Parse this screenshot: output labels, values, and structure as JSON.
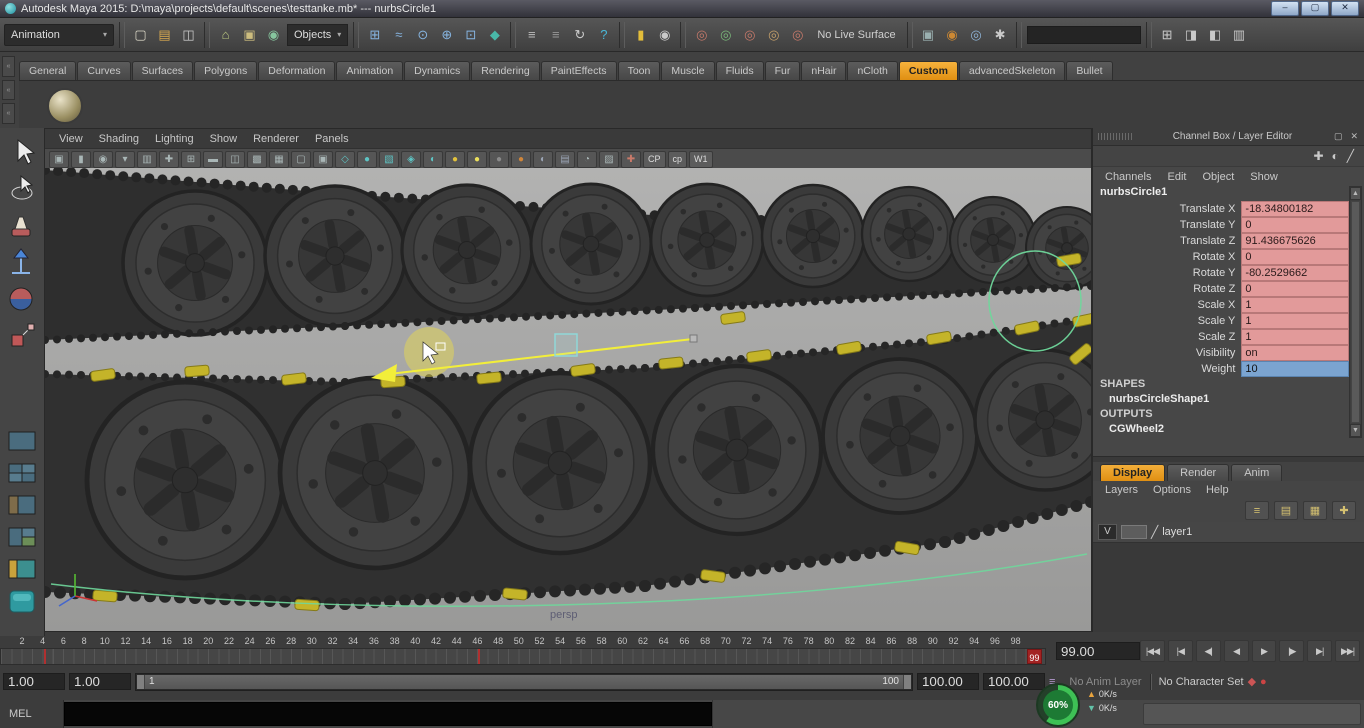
{
  "titlebar": {
    "title": "Autodesk Maya 2015: D:\\maya\\projects\\default\\scenes\\testtanke.mb*   ---   nurbsCircle1",
    "minimize": "–",
    "maximize": "▢",
    "close": "✕"
  },
  "toolbar": {
    "menuset": "Animation",
    "live_surface_label": "No Live Surface",
    "coordinate_input_value": "",
    "items": [
      {
        "t": "i",
        "n": "new-scene",
        "g": "▢",
        "c": "#d8d4c4"
      },
      {
        "t": "i",
        "n": "open-scene",
        "g": "▤",
        "c": "#d9a94f"
      },
      {
        "t": "i",
        "n": "save-scene",
        "g": "◫",
        "c": "#c9c9c9"
      },
      {
        "t": "sep"
      },
      {
        "t": "i",
        "n": "select-by-hierarchy",
        "g": "⌂",
        "c": "#bac87f"
      },
      {
        "t": "i",
        "n": "select-by-object-type",
        "g": "▣",
        "c": "#cdbd7e"
      },
      {
        "t": "i",
        "n": "select-by-component-type",
        "g": "◉",
        "c": "#86c79e"
      },
      {
        "t": "field",
        "n": "selection-mask",
        "label": "Objects"
      },
      {
        "t": "sep"
      },
      {
        "t": "i",
        "n": "snap-to-grid",
        "g": "⊞",
        "c": "#86b4e0"
      },
      {
        "t": "i",
        "n": "snap-to-curve",
        "g": "≈",
        "c": "#86b4e0"
      },
      {
        "t": "i",
        "n": "snap-to-point",
        "g": "⊙",
        "c": "#86b4e0"
      },
      {
        "t": "i",
        "n": "snap-to-projected-center",
        "g": "⊕",
        "c": "#86b4e0"
      },
      {
        "t": "i",
        "n": "snap-to-view-plane",
        "g": "⊡",
        "c": "#86b4e0"
      },
      {
        "t": "i",
        "n": "make-object-live",
        "g": "◆",
        "c": "#49b8a8"
      },
      {
        "t": "sep"
      },
      {
        "t": "i",
        "n": "input-connections",
        "g": "≡",
        "c": "#bdbdbd"
      },
      {
        "t": "i",
        "n": "output-connections",
        "g": "≡",
        "c": "#979797"
      },
      {
        "t": "i",
        "n": "construction-history-toggle",
        "g": "↻",
        "c": "#cccccc"
      },
      {
        "t": "i",
        "n": "quick-help",
        "g": "?",
        "c": "#49b8d8"
      },
      {
        "t": "sep"
      },
      {
        "t": "i",
        "n": "lock-selection",
        "g": "▮",
        "c": "#e3bd3a"
      },
      {
        "t": "i",
        "n": "highlight-selection-mode",
        "g": "◉",
        "c": "#c9c9c9"
      },
      {
        "t": "sep"
      },
      {
        "t": "i",
        "n": "keying-mask-translate",
        "g": "◎",
        "c": "#c6796a"
      },
      {
        "t": "i",
        "n": "keying-mask-rotate",
        "g": "◎",
        "c": "#7ab87a"
      },
      {
        "t": "i",
        "n": "keying-mask-scale",
        "g": "◎",
        "c": "#c6796a"
      },
      {
        "t": "i",
        "n": "keying-mask-custom",
        "g": "◎",
        "c": "#c6a06a"
      },
      {
        "t": "i",
        "n": "keying-mask-all",
        "g": "◎",
        "c": "#c6796a"
      },
      {
        "t": "label",
        "n": "live-surface-label"
      },
      {
        "t": "sep"
      },
      {
        "t": "i",
        "n": "open-render-view",
        "g": "▣",
        "c": "#9ab0b0"
      },
      {
        "t": "i",
        "n": "render-current-frame",
        "g": "◉",
        "c": "#cc8833"
      },
      {
        "t": "i",
        "n": "ipr-render",
        "g": "◎",
        "c": "#8fb4d8"
      },
      {
        "t": "i",
        "n": "render-settings",
        "g": "✱",
        "c": "#c9c9c9"
      },
      {
        "t": "sep"
      },
      {
        "t": "input",
        "n": "coordinate-input"
      },
      {
        "t": "sep"
      },
      {
        "t": "i",
        "n": "toggle-grid-display",
        "g": "⊞",
        "c": "#c9c9c9"
      },
      {
        "t": "i",
        "n": "toggle-attribute-editor",
        "g": "◨",
        "c": "#c9c9c9"
      },
      {
        "t": "i",
        "n": "toggle-tool-settings",
        "g": "◧",
        "c": "#c9c9c9"
      },
      {
        "t": "i",
        "n": "toggle-channel-box",
        "g": "▥",
        "c": "#c9c9c9"
      }
    ]
  },
  "shelf": {
    "tabs": [
      "General",
      "Curves",
      "Surfaces",
      "Polygons",
      "Deformation",
      "Animation",
      "Dynamics",
      "Rendering",
      "PaintEffects",
      "Toon",
      "Muscle",
      "Fluids",
      "Fur",
      "nHair",
      "nCloth",
      "Custom",
      "advancedSkeleton",
      "Bullet"
    ],
    "active_tab": "Custom"
  },
  "viewport": {
    "menus": [
      "View",
      "Shading",
      "Lighting",
      "Show",
      "Renderer",
      "Panels"
    ],
    "camera_label": "persp",
    "toolbar_icons": [
      {
        "n": "select-camera",
        "g": "▣",
        "c": "#a9b6b6"
      },
      {
        "n": "lock-camera",
        "g": "▮",
        "c": "#a9b6b6"
      },
      {
        "n": "camera-attributes",
        "g": "◉",
        "c": "#a9b6b6"
      },
      {
        "n": "bookmarks",
        "g": "▾",
        "c": "#a9b6b6"
      },
      {
        "n": "image-plane",
        "g": "▥",
        "c": "#a9b6b6"
      },
      {
        "n": "2d-pan-zoom",
        "g": "✚",
        "c": "#a9b6b6"
      },
      {
        "n": "grid-toggle",
        "g": "⊞",
        "c": "#a9b6b6"
      },
      {
        "n": "film-gate",
        "g": "▬",
        "c": "#a9b6b6"
      },
      {
        "n": "resolution-gate",
        "g": "◫",
        "c": "#a9b6b6"
      },
      {
        "n": "gate-mask",
        "g": "▩",
        "c": "#a9b6b6"
      },
      {
        "n": "field-chart",
        "g": "▦",
        "c": "#a9b6b6"
      },
      {
        "n": "safe-action",
        "g": "▢",
        "c": "#a9b6b6"
      },
      {
        "n": "safe-title",
        "g": "▣",
        "c": "#a9b6b6"
      },
      {
        "n": "wireframe-mode",
        "g": "◇",
        "c": "#5ec4c4"
      },
      {
        "n": "smooth-shade-mode",
        "g": "●",
        "c": "#5ec4c4"
      },
      {
        "n": "textured-mode",
        "g": "▧",
        "c": "#5ec4c4"
      },
      {
        "n": "wireframe-on-shaded",
        "g": "◈",
        "c": "#5ec4c4"
      },
      {
        "n": "default-material",
        "g": "◐",
        "c": "#5ec4c4"
      },
      {
        "n": "use-all-lights",
        "g": "●",
        "c": "#e2c23c"
      },
      {
        "n": "flat-lighting",
        "g": "●",
        "c": "#ece05c"
      },
      {
        "n": "shadows",
        "g": "●",
        "c": "#8a8a8a"
      },
      {
        "n": "screen-space-ao",
        "g": "●",
        "c": "#d0863a"
      },
      {
        "n": "motion-blur",
        "g": "◐",
        "c": "#9aa4b4"
      },
      {
        "n": "anti-aliasing",
        "g": "▤",
        "c": "#9aa4b4"
      },
      {
        "n": "isolate-select",
        "g": "◔",
        "c": "#a9b6b6"
      },
      {
        "n": "xray-mode",
        "g": "▨",
        "c": "#a9b6b6"
      },
      {
        "n": "xray-joints",
        "g": "✚",
        "c": "#c97a6a"
      }
    ],
    "text_buttons": [
      {
        "n": "cp-display-toggle",
        "label": "CP"
      },
      {
        "n": "cp-edit-toggle",
        "label": "cp"
      },
      {
        "n": "wireframe-color-toggle",
        "label": "W1"
      }
    ]
  },
  "channel_box": {
    "header": "Channel Box / Layer Editor",
    "header_icons": [
      {
        "n": "pin-channel-box-icon",
        "g": "✚",
        "c": "#c9c9c9"
      },
      {
        "n": "manipulator-link-icon",
        "g": "◐",
        "c": "#c9c9c9"
      },
      {
        "n": "speed-slider-icon",
        "g": "╱",
        "c": "#c9c9c9"
      }
    ],
    "window_icons": {
      "float": "▢",
      "close": "✕"
    },
    "menus": [
      "Channels",
      "Edit",
      "Object",
      "Show"
    ],
    "object_name": "nurbsCircle1",
    "channels": [
      {
        "label": "Translate X",
        "value": "-18.34800182",
        "style": "keyed"
      },
      {
        "label": "Translate Y",
        "value": "0",
        "style": "keyed"
      },
      {
        "label": "Translate Z",
        "value": "91.436675626",
        "style": "keyed"
      },
      {
        "label": "Rotate X",
        "value": "0",
        "style": "keyed"
      },
      {
        "label": "Rotate Y",
        "value": "-80.2529662",
        "style": "keyed"
      },
      {
        "label": "Rotate Z",
        "value": "0",
        "style": "keyed"
      },
      {
        "label": "Scale X",
        "value": "1",
        "style": "keyed"
      },
      {
        "label": "Scale Y",
        "value": "1",
        "style": "keyed"
      },
      {
        "label": "Scale Z",
        "value": "1",
        "style": "keyed"
      },
      {
        "label": "Visibility",
        "value": "on",
        "style": "keyed"
      },
      {
        "label": "Weight",
        "value": "10",
        "style": "selected"
      }
    ],
    "shapes_header": "SHAPES",
    "shape_name": "nurbsCircleShape1",
    "outputs_header": "OUTPUTS",
    "output_name": "CGWheel2"
  },
  "layer_editor": {
    "tabs": [
      "Display",
      "Render",
      "Anim"
    ],
    "active_tab": "Display",
    "menus": [
      "Layers",
      "Options",
      "Help"
    ],
    "icons": [
      {
        "n": "layer-sort-icon",
        "g": "≡"
      },
      {
        "n": "create-empty-layer-icon",
        "g": "▤"
      },
      {
        "n": "create-layer-from-selected-icon",
        "g": "▦"
      },
      {
        "n": "layer-options-icon",
        "g": "✚"
      }
    ],
    "layers": [
      {
        "visible": "V",
        "name": "layer1"
      }
    ]
  },
  "timeline": {
    "frame_numbers": [
      "2",
      "4",
      "6",
      "8",
      "10",
      "12",
      "14",
      "16",
      "18",
      "20",
      "22",
      "24",
      "26",
      "28",
      "30",
      "32",
      "34",
      "36",
      "38",
      "40",
      "42",
      "44",
      "46",
      "48",
      "50",
      "52",
      "54",
      "56",
      "58",
      "60",
      "62",
      "64",
      "66",
      "68",
      "70",
      "72",
      "74",
      "76",
      "78",
      "80",
      "82",
      "84",
      "86",
      "88",
      "90",
      "92",
      "94",
      "96",
      "98"
    ],
    "key_frames": [
      4,
      46
    ],
    "current_frame": "99",
    "current_time_field": "99.00",
    "playback": [
      {
        "n": "go-to-start-button",
        "g": "|◀◀"
      },
      {
        "n": "step-back-key-button",
        "g": "|◀"
      },
      {
        "n": "step-back-frame-button",
        "g": "◀|"
      },
      {
        "n": "play-backwards-button",
        "g": "◀"
      },
      {
        "n": "play-forwards-button",
        "g": "▶"
      },
      {
        "n": "step-forward-frame-button",
        "g": "|▶"
      },
      {
        "n": "step-forward-key-button",
        "g": "▶|"
      },
      {
        "n": "go-to-end-button",
        "g": "▶▶|"
      }
    ]
  },
  "range_slider": {
    "playback_start": "1.00",
    "anim_start": "1.00",
    "range_start_label": "1",
    "range_end_label": "100",
    "anim_end": "100.00",
    "playback_end": "100.00",
    "anim_layer_label": "No Anim Layer",
    "character_set_label": "No Character Set",
    "anim_layer_icon": "≡",
    "key_icon": "◆",
    "auto_key_icon": "●"
  },
  "command_line": {
    "label": "MEL",
    "input_value": ""
  },
  "status": {
    "progress": "60%",
    "up_rate": "0K/s",
    "down_rate": "0K/s",
    "up_icon": "▲",
    "down_icon": "▼"
  },
  "colors": {
    "accent_orange": "#f0a01e",
    "keyed_field": "#e29a9a",
    "selected_field": "#7ba4d0",
    "viewport_bg": "#a8a8a7",
    "yellow_pad": "#c4b429",
    "manip_yellow": "#f2ee3a",
    "curve_green": "#6fd79b"
  }
}
